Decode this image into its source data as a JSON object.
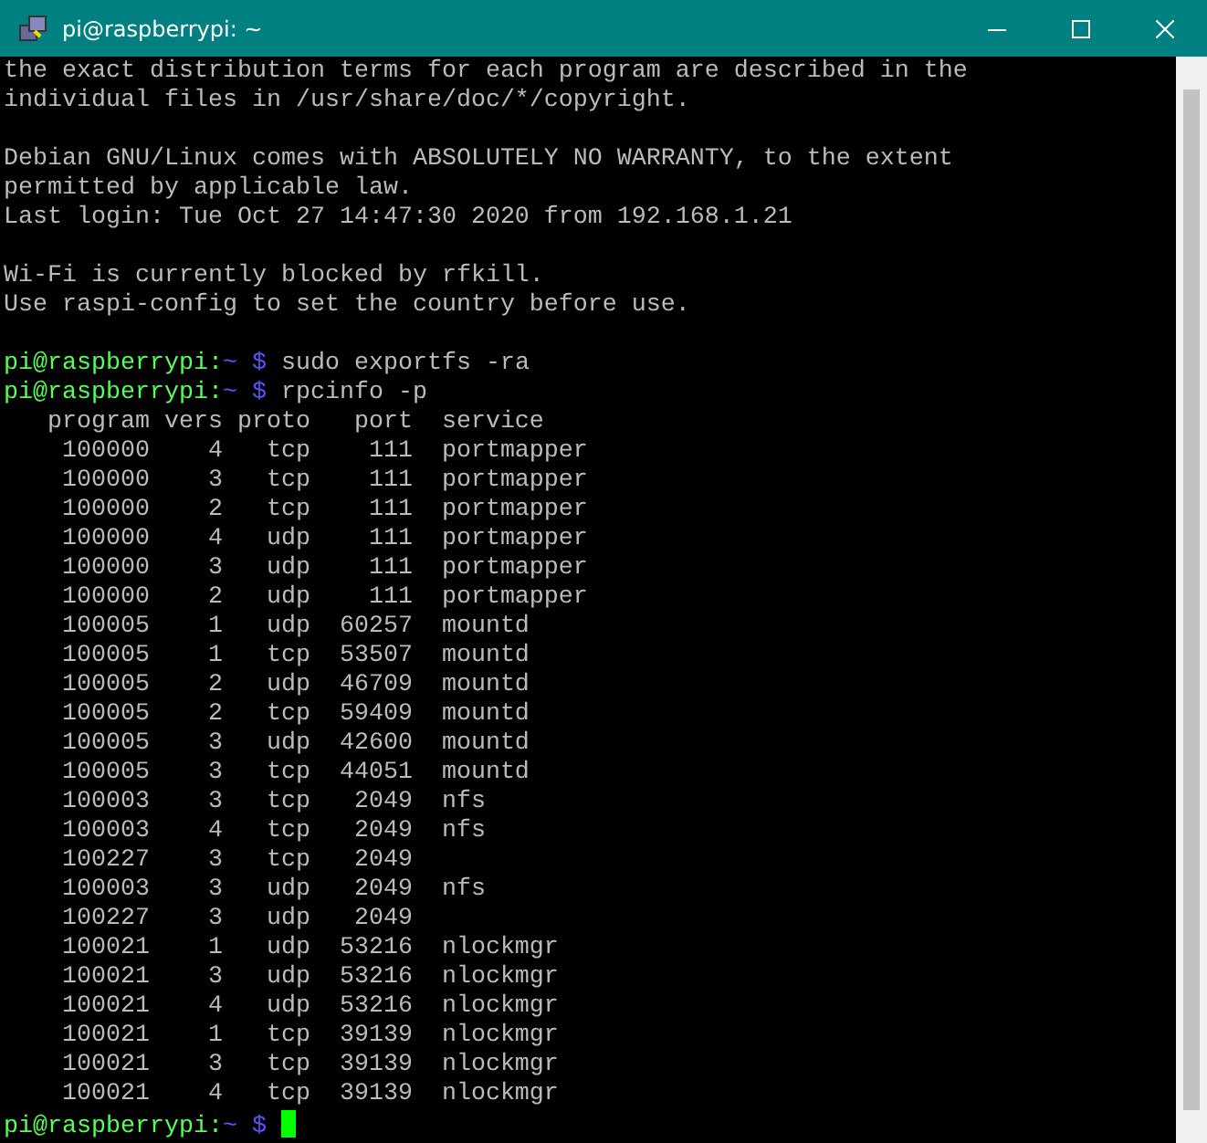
{
  "window": {
    "title": "pi@raspberrypi: ~"
  },
  "terminal": {
    "lines": [
      {
        "kind": "text",
        "text": "the exact distribution terms for each program are described in the"
      },
      {
        "kind": "text",
        "text": "individual files in /usr/share/doc/*/copyright."
      },
      {
        "kind": "blank"
      },
      {
        "kind": "text",
        "text": "Debian GNU/Linux comes with ABSOLUTELY NO WARRANTY, to the extent"
      },
      {
        "kind": "text",
        "text": "permitted by applicable law."
      },
      {
        "kind": "text",
        "text": "Last login: Tue Oct 27 14:47:30 2020 from 192.168.1.21"
      },
      {
        "kind": "blank"
      },
      {
        "kind": "text",
        "text": "Wi-Fi is currently blocked by rfkill."
      },
      {
        "kind": "text",
        "text": "Use raspi-config to set the country before use."
      },
      {
        "kind": "blank"
      },
      {
        "kind": "prompt",
        "user": "pi@raspberrypi:",
        "path": "~",
        "symbol": "$",
        "command": "sudo exportfs -ra"
      },
      {
        "kind": "prompt",
        "user": "pi@raspberrypi:",
        "path": "~",
        "symbol": "$",
        "command": "rpcinfo -p"
      },
      {
        "kind": "text",
        "text": "   program vers proto   port  service"
      },
      {
        "kind": "text",
        "text": "    100000    4   tcp    111  portmapper"
      },
      {
        "kind": "text",
        "text": "    100000    3   tcp    111  portmapper"
      },
      {
        "kind": "text",
        "text": "    100000    2   tcp    111  portmapper"
      },
      {
        "kind": "text",
        "text": "    100000    4   udp    111  portmapper"
      },
      {
        "kind": "text",
        "text": "    100000    3   udp    111  portmapper"
      },
      {
        "kind": "text",
        "text": "    100000    2   udp    111  portmapper"
      },
      {
        "kind": "text",
        "text": "    100005    1   udp  60257  mountd"
      },
      {
        "kind": "text",
        "text": "    100005    1   tcp  53507  mountd"
      },
      {
        "kind": "text",
        "text": "    100005    2   udp  46709  mountd"
      },
      {
        "kind": "text",
        "text": "    100005    2   tcp  59409  mountd"
      },
      {
        "kind": "text",
        "text": "    100005    3   udp  42600  mountd"
      },
      {
        "kind": "text",
        "text": "    100005    3   tcp  44051  mountd"
      },
      {
        "kind": "text",
        "text": "    100003    3   tcp   2049  nfs"
      },
      {
        "kind": "text",
        "text": "    100003    4   tcp   2049  nfs"
      },
      {
        "kind": "text",
        "text": "    100227    3   tcp   2049"
      },
      {
        "kind": "text",
        "text": "    100003    3   udp   2049  nfs"
      },
      {
        "kind": "text",
        "text": "    100227    3   udp   2049"
      },
      {
        "kind": "text",
        "text": "    100021    1   udp  53216  nlockmgr"
      },
      {
        "kind": "text",
        "text": "    100021    3   udp  53216  nlockmgr"
      },
      {
        "kind": "text",
        "text": "    100021    4   udp  53216  nlockmgr"
      },
      {
        "kind": "text",
        "text": "    100021    1   tcp  39139  nlockmgr"
      },
      {
        "kind": "text",
        "text": "    100021    3   tcp  39139  nlockmgr"
      },
      {
        "kind": "text",
        "text": "    100021    4   tcp  39139  nlockmgr"
      },
      {
        "kind": "prompt",
        "user": "pi@raspberrypi:",
        "path": "~",
        "symbol": "$",
        "cursor": true
      }
    ]
  }
}
